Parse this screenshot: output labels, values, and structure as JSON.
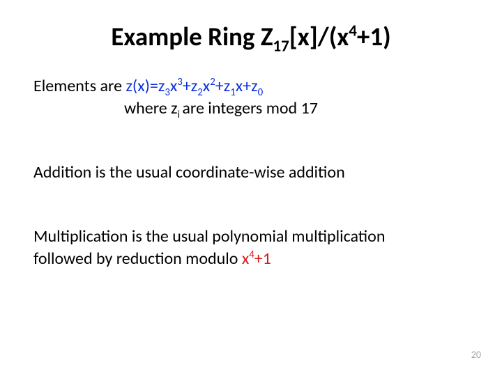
{
  "title": {
    "t1": "Example Ring Z",
    "t_sub": "17",
    "t2": "[x]/(x",
    "t_sup": "4",
    "t3": "+1)"
  },
  "line1": {
    "a": "Elements are ",
    "b": "z(x)=z",
    "s3": "3",
    "c": "x",
    "p3": "3",
    "d": "+z",
    "s2": "2",
    "e": "x",
    "p2": "2",
    "f": "+z",
    "s1": "1",
    "g": "x+z",
    "s0": "0"
  },
  "line2": {
    "a": "where z",
    "sub": "i ",
    "b": "are integers mod 17"
  },
  "line3": "Addition is the usual coordinate-wise addition",
  "line4a": "Multiplication is the usual polynomial multiplication",
  "line4b": {
    "a": "followed by reduction modulo ",
    "b": "x",
    "sup": "4",
    "c": "+1"
  },
  "page": "20"
}
